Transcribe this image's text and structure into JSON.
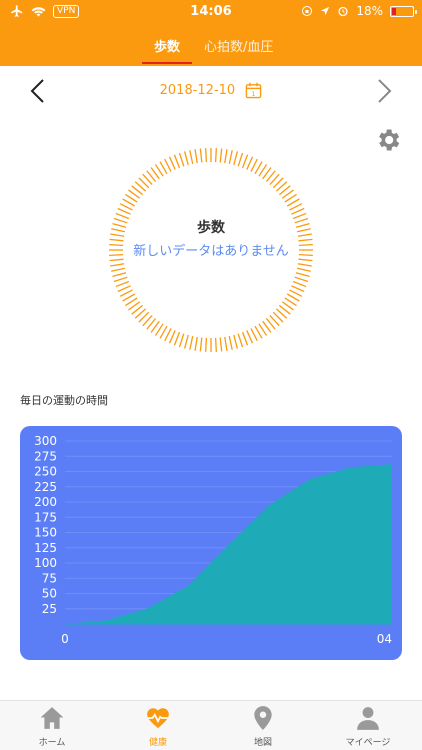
{
  "status_bar": {
    "vpn": "VPN",
    "time": "14:06",
    "battery": "18%"
  },
  "tabs": [
    {
      "label": "歩数",
      "active": true
    },
    {
      "label": "心拍数/血圧",
      "active": false
    }
  ],
  "date": "2018-12-10",
  "calendar_day": "1",
  "ring": {
    "title": "歩数",
    "message": "新しいデータはありません"
  },
  "section_label": "毎日の運動の時間",
  "chart_data": {
    "type": "area",
    "x": [
      "0",
      "04"
    ],
    "curve_x": [
      0,
      0.5,
      1,
      1.5,
      2,
      2.5,
      3,
      3.5,
      4
    ],
    "curve_y": [
      0,
      6,
      25,
      62,
      130,
      195,
      238,
      257,
      262
    ],
    "yticks": [
      25,
      50,
      75,
      100,
      125,
      150,
      175,
      200,
      225,
      250,
      275,
      300
    ],
    "ylim": [
      0,
      300
    ],
    "xlim": [
      0,
      4
    ],
    "area_color": "#1eaab7",
    "background": "#5b7ef6"
  },
  "bottom_nav": [
    {
      "label": "ホーム",
      "icon": "home-icon",
      "active": false
    },
    {
      "label": "健康",
      "icon": "heartbeat-icon",
      "active": true
    },
    {
      "label": "地図",
      "icon": "map-pin-icon",
      "active": false
    },
    {
      "label": "マイページ",
      "icon": "user-icon",
      "active": false
    }
  ],
  "colors": {
    "accent": "#fb9a0e",
    "tab_underline": "#e0241c",
    "message": "#5b8cf0"
  }
}
